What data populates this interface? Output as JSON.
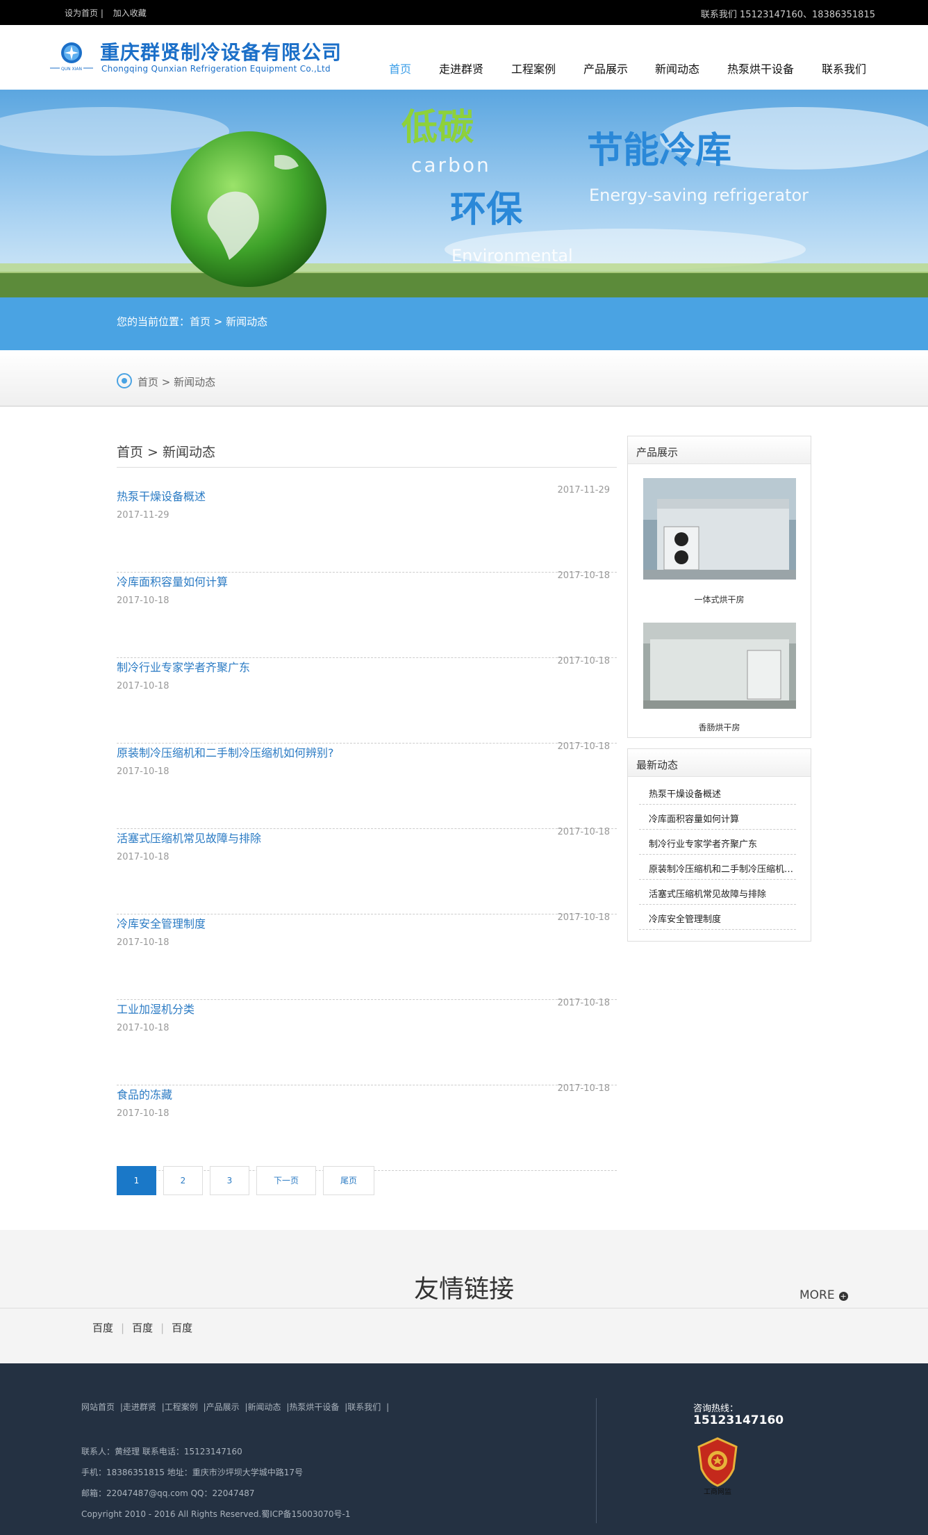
{
  "topbar": {
    "set_home": "设为首页 |",
    "add_fav": "加入收藏",
    "contact": "联系我们   15123147160、18386351815"
  },
  "header": {
    "logo_cn": "重庆群贤制冷设备有限公司",
    "logo_en": "Chongqing Qunxian Refrigeration Equipment Co.,Ltd",
    "logo_badge": "QUN XIAN"
  },
  "nav": [
    "首页",
    "走进群贤",
    "工程案例",
    "产品展示",
    "新闻动态",
    "热泵烘干设备",
    "联系我们"
  ],
  "banner": {
    "t1": "低碳",
    "t1_en": "carbon",
    "t2": "环保",
    "t2_en": "Environmental",
    "t3": "节能冷库",
    "t3_en": "Energy-saving refrigerator"
  },
  "location": "您的当前位置：首页 > 新闻动态",
  "crumb": "首页 > 新闻动态",
  "list_title": "首页 > 新闻动态",
  "news": [
    {
      "title": "热泵干燥设备概述",
      "date": "2017-11-29"
    },
    {
      "title": "冷库面积容量如何计算",
      "date": "2017-10-18"
    },
    {
      "title": "制冷行业专家学者齐聚广东",
      "date": "2017-10-18"
    },
    {
      "title": "原装制冷压缩机和二手制冷压缩机如何辨别?",
      "date": "2017-10-18"
    },
    {
      "title": "活塞式压缩机常见故障与排除",
      "date": "2017-10-18"
    },
    {
      "title": "冷库安全管理制度",
      "date": "2017-10-18"
    },
    {
      "title": "工业加湿机分类",
      "date": "2017-10-18"
    },
    {
      "title": "食品的冻藏",
      "date": "2017-10-18"
    }
  ],
  "pagination": [
    "1",
    "2",
    "3",
    "下一页",
    "尾页"
  ],
  "sidebar": {
    "products_title": "产品展示",
    "products": [
      "一体式烘干房",
      "香肠烘干房"
    ],
    "news_title": "最新动态",
    "latest": [
      "热泵干燥设备概述",
      "冷库面积容量如何计算",
      "制冷行业专家学者齐聚广东",
      "原装制冷压缩机和二手制冷压缩机如何辨别?",
      "活塞式压缩机常见故障与排除",
      "冷库安全管理制度"
    ]
  },
  "links": {
    "title": "友情链接",
    "more": "MORE",
    "items": [
      "百度",
      "百度",
      "百度"
    ]
  },
  "footer": {
    "nav": [
      "网站首页",
      "|走进群贤",
      "|工程案例",
      "|产品展示",
      "|新闻动态",
      "|热泵烘干设备",
      "|联系我们",
      "|"
    ],
    "line1": "联系人：黄经理 联系电话：15123147160",
    "line2": "手机：18386351815 地址：重庆市沙坪坝大学城中路17号",
    "line3": "邮箱：22047487@qq.com QQ：22047487",
    "line4": "Copyright 2010 - 2016 All Rights Reserved.蜀ICP备15003070号-1",
    "hotline_label": "咨询热线：",
    "hotline": "15123147160",
    "emblem_text": "工商网监"
  },
  "colors": {
    "accent": "#4aa3e3",
    "link": "#2b7bc4",
    "footer": "#243142",
    "active_page": "#1a78c8"
  }
}
